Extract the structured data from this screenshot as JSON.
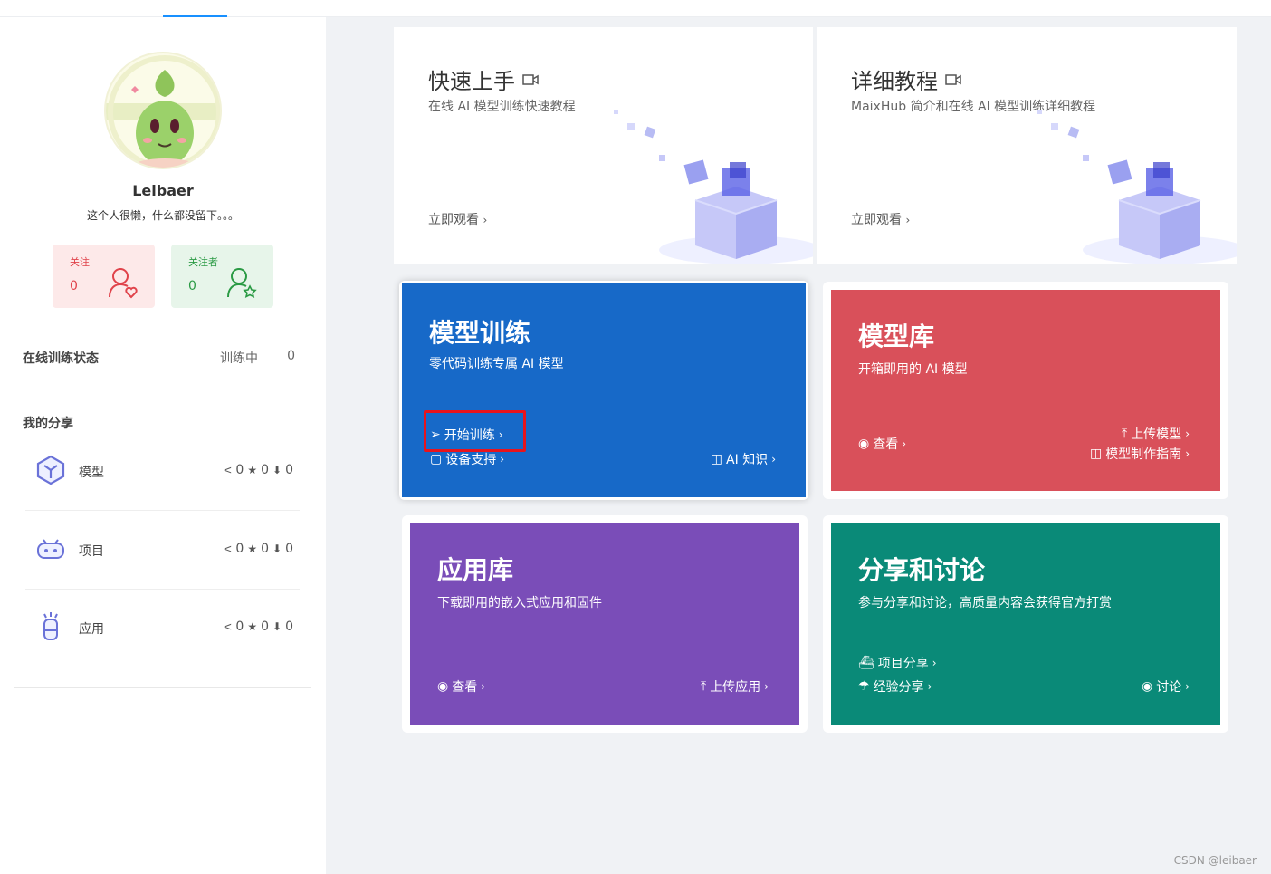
{
  "profile": {
    "username": "Leibaer",
    "bio": "这个人很懒，什么都没留下。。。",
    "follow_label": "关注",
    "follow_count": "0",
    "fans_label": "关注者",
    "fans_count": "0"
  },
  "training_status": {
    "label": "在线训练状态",
    "status": "训练中",
    "count": "0"
  },
  "my_share": {
    "title": "我的分享",
    "items": [
      {
        "name": "模型",
        "icon": "cube-icon",
        "shares": "0",
        "stars": "0",
        "downloads": "0"
      },
      {
        "name": "项目",
        "icon": "robot-icon",
        "shares": "0",
        "stars": "0",
        "downloads": "0"
      },
      {
        "name": "应用",
        "icon": "flask-icon",
        "shares": "0",
        "stars": "0",
        "downloads": "0"
      }
    ]
  },
  "tutorials": [
    {
      "title": "快速上手",
      "desc": "在线 AI 模型训练快速教程",
      "watch": "立即观看"
    },
    {
      "title": "详细教程",
      "desc": "MaixHub 简介和在线 AI 模型训练详细教程",
      "watch": "立即观看"
    }
  ],
  "cards": {
    "train": {
      "title": "模型训练",
      "desc": "零代码训练专属 AI 模型",
      "start": "开始训练",
      "device": "设备支持",
      "ai": "AI 知识"
    },
    "model_lib": {
      "title": "模型库",
      "desc": "开箱即用的 AI 模型",
      "view": "查看",
      "upload": "上传模型",
      "guide": "模型制作指南"
    },
    "app_lib": {
      "title": "应用库",
      "desc": "下载即用的嵌入式应用和固件",
      "view": "查看",
      "upload": "上传应用"
    },
    "share": {
      "title": "分享和讨论",
      "desc": "参与分享和讨论，高质量内容会获得官方打赏",
      "project": "项目分享",
      "exp": "经验分享",
      "discuss": "讨论"
    }
  },
  "colors": {
    "train": "#1769c8",
    "model_lib": "#d9505a",
    "app_lib": "#7a4db8",
    "share": "#0a8a78",
    "highlight": "#e8141c"
  },
  "footer": "CSDN @leibaer"
}
